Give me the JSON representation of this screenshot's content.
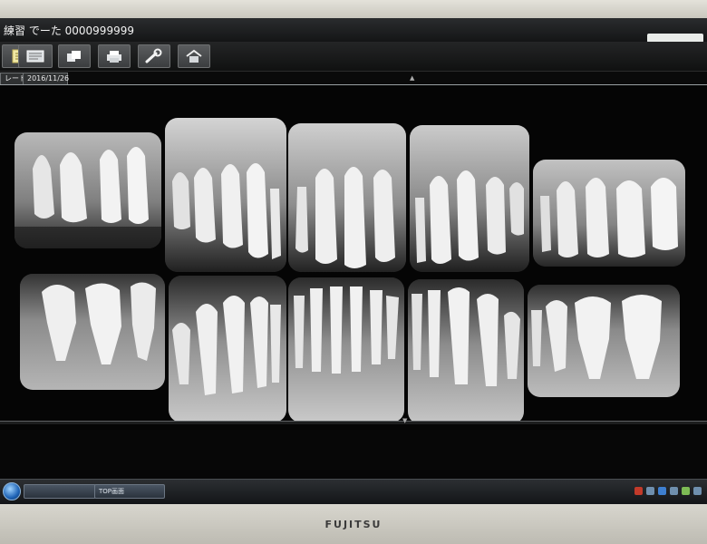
{
  "app": {
    "title": "練習 でーた  0000999999"
  },
  "toolbar": {
    "buttons": [
      {
        "icon": "hand-pointer-icon"
      },
      {
        "icon": "patient-list-icon"
      },
      {
        "icon": "layout-icon"
      },
      {
        "icon": "print-icon"
      },
      {
        "icon": "wrench-icon"
      },
      {
        "icon": "home-icon"
      }
    ]
  },
  "tabs": {
    "template_tab": "レート)",
    "date_tab": "2016/11/26"
  },
  "xrays": {
    "upper": [
      {
        "name": "upper-right-molar"
      },
      {
        "name": "upper-right-premolar"
      },
      {
        "name": "upper-anterior"
      },
      {
        "name": "upper-left-premolar"
      },
      {
        "name": "upper-left-molar"
      }
    ],
    "lower": [
      {
        "name": "lower-right-molar"
      },
      {
        "name": "lower-right-premolar"
      },
      {
        "name": "lower-anterior"
      },
      {
        "name": "lower-left-premolar"
      },
      {
        "name": "lower-left-molar"
      }
    ]
  },
  "taskbar": {
    "task1": "",
    "task2": "TOP画面"
  },
  "monitor": {
    "brand": "FUJITSU"
  }
}
